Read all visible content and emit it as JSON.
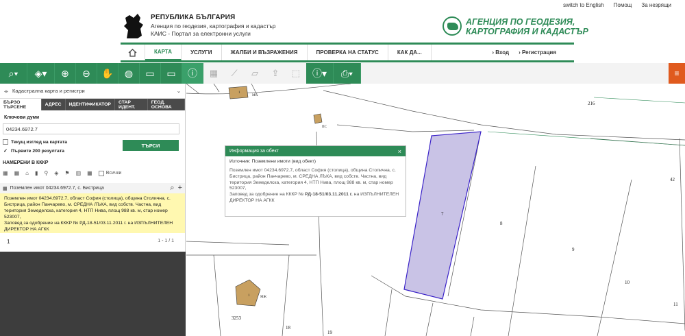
{
  "header": {
    "republic_title": "РЕПУБЛИКА БЪЛГАРИЯ",
    "republic_line1": "Агенция по геодезия, картография и кадастър",
    "republic_line2": "КАИС - Портал за електронни услуги",
    "agency_line1": "АГЕНЦИЯ ПО ГЕОДЕЗИЯ,",
    "agency_line2": "КАРТОГРАФИЯ И КАДАСТЪР",
    "top_links": [
      "switch to English",
      "Помощ",
      "За незрящи"
    ]
  },
  "nav": {
    "items": [
      "КАРТА",
      "УСЛУГИ",
      "ЖАЛБИ И ВЪЗРАЖЕНИЯ",
      "ПРОВЕРКА НА СТАТУС",
      "КАК ДА..."
    ],
    "login": "Вход",
    "register": "Регистрация"
  },
  "sidebar": {
    "header": "Кадастрална карта и регистри",
    "tabs": [
      "БЪРЗО ТЪРСЕНЕ",
      "АДРЕС",
      "ИДЕНТИФИКАТОР",
      "СТАР ИДЕНТ.",
      "ГЕОД. ОСНОВА"
    ],
    "keywords_label": "Ключови думи",
    "keywords_value": "04234.6972.7",
    "current_view_label": "Текущ изглед на картата",
    "first200_label": "Първите 200 резултата",
    "search_button": "ТЪРСИ",
    "found_title": "НАМЕРЕНИ В КККР",
    "all_label": "Всички",
    "result_title": "Поземлен имот 04234.6972.7, с. Бистрица",
    "result_text": "Поземлен имот 04234.6972.7, област София (столица), община Столична, с. Бистрица, район Панчарево, м. СРЕДНА ЛЪКА, вид собств. Частна, вид територия Земеделска, категория 4, НТП Нива, площ 988 кв. м, стар номер 523007,",
    "result_order": "Заповед за одобрение на КККР № РД-18-51/03.11.2011 г. на ИЗПЪЛНИТЕЛЕН ДИРЕКТОР НА АГКК",
    "page": "1",
    "page_range": "1 - 1 / 1"
  },
  "popup": {
    "title": "Информация за обект",
    "source": "Източник: Поземлени имоти (вид обект)",
    "body": "Поземлен имот 04234.6972.7, област София (столица), община Столична, с. Бистрица, район Панчарево, м. СРЕДНА ЛЪКА, вид собств. Частна, вид територия Земеделска, категория 4, НТП Нива, площ 988 кв. м, стар номер 523007,",
    "order_prefix": "Заповед за одобрение на КККР №",
    "order_number": "РД-18-51/03.11.2011 г.",
    "order_suffix": "на ИЗПЪЛНИТЕЛЕН ДИРЕКТОР НА АГКК"
  },
  "map": {
    "labels": [
      "216",
      "42",
      "7",
      "8",
      "9",
      "10",
      "11",
      "3253",
      "18",
      "19",
      "МС",
      "ПС",
      "1",
      "1",
      "МЖ"
    ],
    "highlight_color": "#c9c3e6",
    "highlight_stroke": "#3a22c8"
  },
  "colors": {
    "brand_green": "#2e8b57",
    "orange": "#e05a1e",
    "result_yellow": "#fff8b0"
  }
}
